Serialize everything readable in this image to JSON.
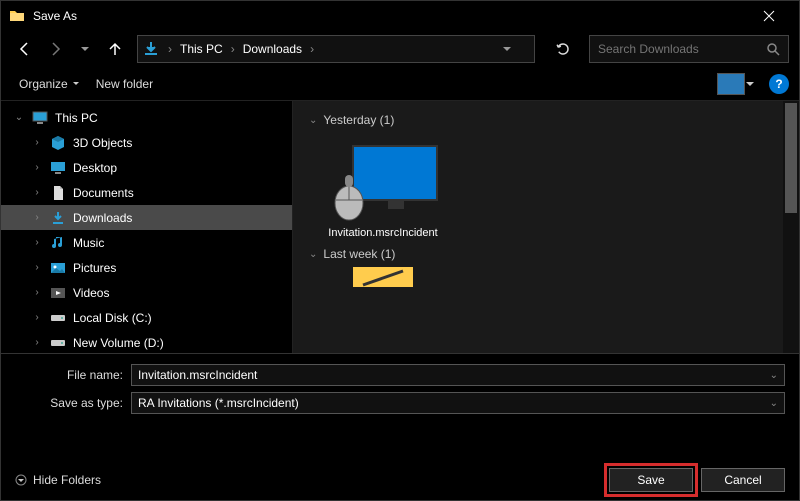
{
  "window": {
    "title": "Save As"
  },
  "breadcrumb": {
    "root": "This PC",
    "folder": "Downloads"
  },
  "search": {
    "placeholder": "Search Downloads"
  },
  "toolbar": {
    "organize": "Organize",
    "newfolder": "New folder"
  },
  "tree": {
    "root": "This PC",
    "items": [
      {
        "label": "3D Objects",
        "icon": "cube"
      },
      {
        "label": "Desktop",
        "icon": "desktop"
      },
      {
        "label": "Documents",
        "icon": "doc"
      },
      {
        "label": "Downloads",
        "icon": "download",
        "selected": true
      },
      {
        "label": "Music",
        "icon": "music"
      },
      {
        "label": "Pictures",
        "icon": "pic"
      },
      {
        "label": "Videos",
        "icon": "video"
      },
      {
        "label": "Local Disk (C:)",
        "icon": "disk"
      },
      {
        "label": "New Volume (D:)",
        "icon": "disk"
      }
    ]
  },
  "content": {
    "group1": {
      "header": "Yesterday (1)",
      "file": "Invitation.msrcIncident"
    },
    "group2": {
      "header": "Last week (1)"
    }
  },
  "fields": {
    "filename_label": "File name:",
    "filename_value": "Invitation.msrcIncident",
    "type_label": "Save as type:",
    "type_value": "RA Invitations (*.msrcIncident)"
  },
  "bottom": {
    "hidefolders": "Hide Folders",
    "save": "Save",
    "cancel": "Cancel"
  }
}
